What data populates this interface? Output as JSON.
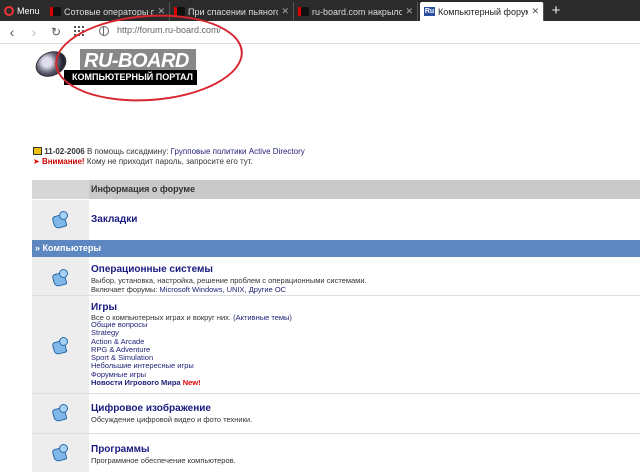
{
  "browser": {
    "menu_label": "Menu",
    "tabs": [
      {
        "title": "Сотовые операторы пре"
      },
      {
        "title": "При спасении пьяного в"
      },
      {
        "title": "ru-board.com накрылся?"
      },
      {
        "title": "Компьютерный форум Ru",
        "active": true,
        "favicon": "Ru"
      }
    ],
    "new_tab": "+",
    "url": "http://forum.ru-board.com/"
  },
  "logo": {
    "name": "RU-BOARD",
    "tagline": "КОМПЬЮТЕРНЫЙ ПОРТАЛ"
  },
  "news": {
    "date": "11-02-2006",
    "text": "В помощь сисадмину:",
    "link": "Групповые политики Active Directory",
    "alert_label": "Внимание!",
    "alert_text": "Кому не приходит пароль, запросите его тут."
  },
  "sections": {
    "info_header": "Информация о форуме",
    "bookmarks": "Закладки",
    "computers": "» Компьютеры"
  },
  "forums": {
    "os": {
      "title": "Операционные системы",
      "desc": "Выбор, установка, настройка, решение проблем с операционными системами.",
      "includes_label": "Включает форумы:",
      "links": "Microsoft Windows, UNIX, Другие ОС"
    },
    "games": {
      "title": "Игры",
      "desc": "Все о компьютерных играх и вокруг них.",
      "active_link": "(Активные темы)",
      "subforums": [
        "Общие вопросы",
        "Strategy",
        "Action & Arcade",
        "RPG & Adventure",
        "Sport & Simulation",
        "Небольшие интересные игры",
        "Форумные игры"
      ],
      "news_link": "Новости Игрового Мира",
      "new_badge": "New!"
    },
    "digital": {
      "title": "Цифровое изображение",
      "desc": "Обсуждение цифровой видео и фото техники."
    },
    "programs": {
      "title": "Программы",
      "desc": "Программное обеспечение компьютеров."
    }
  },
  "colors": {
    "section_bar": "#5c87c0",
    "annotation_circle": "#d8262e"
  }
}
